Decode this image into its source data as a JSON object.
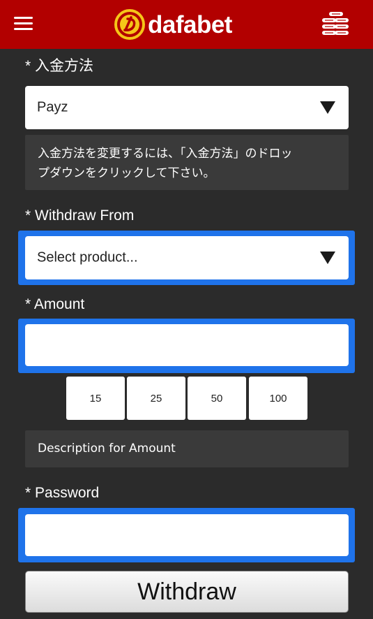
{
  "header": {
    "menu_icon": "hamburger-menu-icon",
    "logo_text": "dafabet",
    "logo_icon": "dafabet-logo-icon",
    "coins_icon": "coin-stack-icon",
    "background_color": "#b20000"
  },
  "form": {
    "deposit_method": {
      "label": "* 入金方法",
      "selected": "Payz",
      "arrow_icon": "dropdown-triangle-icon",
      "help_line1": "入金方法を変更するには、「入金方法」のドロッ",
      "help_line2": "プダウンをクリックして下さい。"
    },
    "withdraw_from": {
      "label": "* Withdraw From",
      "selected": "Select product...",
      "arrow_icon": "dropdown-triangle-icon"
    },
    "amount": {
      "label": "* Amount",
      "value": "",
      "quick_amounts": [
        "15",
        "25",
        "50",
        "100"
      ],
      "description": "Description for Amount"
    },
    "password": {
      "label": "* Password",
      "value": ""
    },
    "submit_label": "Withdraw"
  },
  "colors": {
    "focus_ring": "#1f73ea",
    "background": "#2b2b2b",
    "info_box": "#3a3a3a"
  }
}
